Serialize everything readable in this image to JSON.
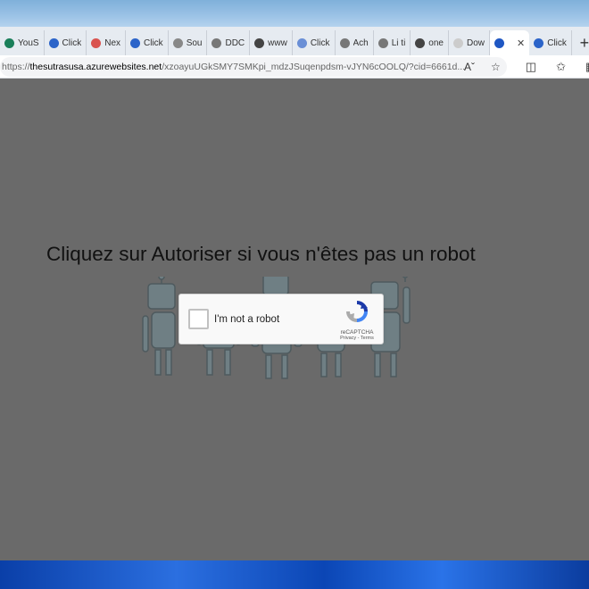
{
  "tabs": [
    {
      "label": "YouS",
      "favicon_color": "#1a7f5a"
    },
    {
      "label": "Click",
      "favicon_color": "#2b64c9"
    },
    {
      "label": "Nex",
      "favicon_color": "#d9534f"
    },
    {
      "label": "Click",
      "favicon_color": "#2b64c9"
    },
    {
      "label": "Sou",
      "favicon_color": "#888888"
    },
    {
      "label": "DDC",
      "favicon_color": "#777777"
    },
    {
      "label": "www",
      "favicon_color": "#444444"
    },
    {
      "label": "Click",
      "favicon_color": "#6a8fd6"
    },
    {
      "label": "Ach",
      "favicon_color": "#777777"
    },
    {
      "label": "Li ti",
      "favicon_color": "#777777"
    },
    {
      "label": "one",
      "favicon_color": "#444444"
    },
    {
      "label": "Dow",
      "favicon_color": "#cccccc"
    }
  ],
  "active_tab": {
    "label": "",
    "favicon_color": "#1f57c3"
  },
  "last_tab": {
    "label": "Click",
    "favicon_color": "#2b64c9"
  },
  "address": {
    "scheme": "https://",
    "host": "thesutrasusa.azurewebsites.net",
    "path": "/xzoayuUGkSMY7SMKpi_mdzJSuqenpdsm-vJYN6cOOLQ/?cid=6661d..."
  },
  "page": {
    "headline": "Cliquez sur Autoriser si vous n'êtes pas un robot"
  },
  "captcha": {
    "label": "I'm not a robot",
    "brand": "reCAPTCHA",
    "privacy": "Privacy",
    "separator": " - ",
    "terms": "Terms"
  }
}
